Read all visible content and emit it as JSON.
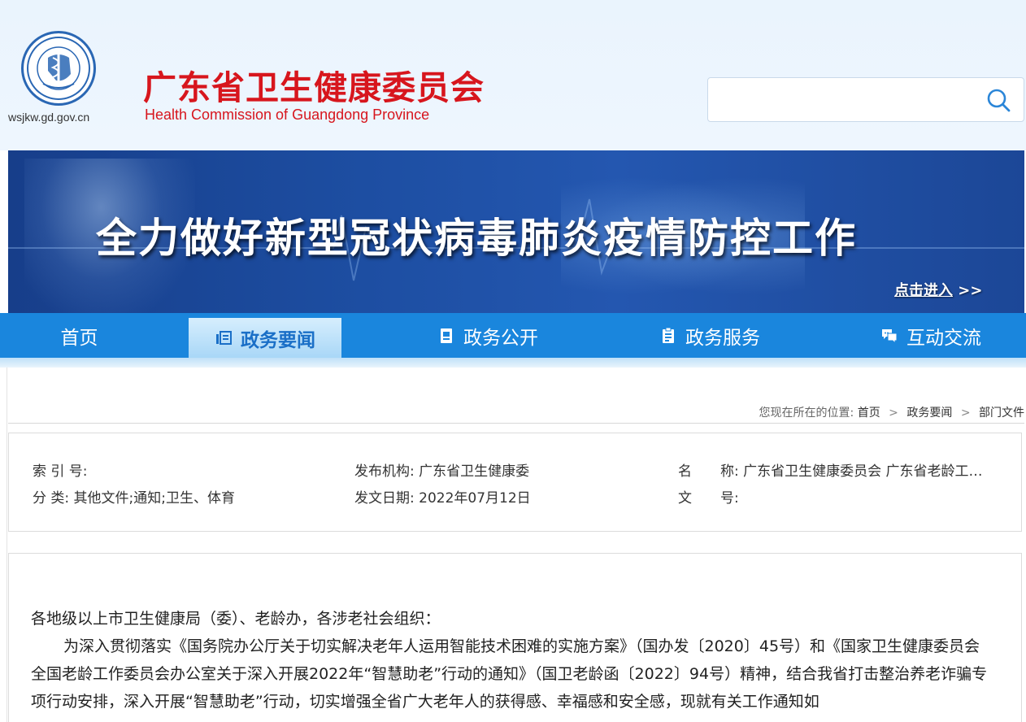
{
  "header": {
    "domain": "wsjkw.gd.gov.cn",
    "title": "广东省卫生健康委员会",
    "subtitle": "Health Commission of Guangdong Province",
    "search": {
      "value": "",
      "placeholder": ""
    },
    "emblem_icon": "health-commission-emblem"
  },
  "banner": {
    "headline": "全力做好新型冠状病毒肺炎疫情防控工作",
    "enter_label": "点击进入",
    "enter_arrows": ">>"
  },
  "nav": {
    "items": [
      {
        "label": "首页",
        "icon": ""
      },
      {
        "label": "政务要闻",
        "icon": "news-icon",
        "active": true
      },
      {
        "label": "政务公开",
        "icon": "document-icon"
      },
      {
        "label": "政务服务",
        "icon": "clipboard-icon"
      },
      {
        "label": "互动交流",
        "icon": "chat-icon"
      }
    ]
  },
  "breadcrumb": {
    "prefix": "您现在所在的位置:",
    "items": [
      "首页",
      "政务要闻",
      "部门文件"
    ],
    "separator": ">"
  },
  "meta": {
    "index_label": "索 引 号:",
    "index_value": "",
    "publisher_label": "发布机构:",
    "publisher_value": "广东省卫生健康委",
    "name_label": "名",
    "name_label_2": "称:",
    "name_value": "广东省卫生健康委员会 广东省老龄工…",
    "category_label": "分 类:",
    "category_value": "其他文件;通知;卫生、体育",
    "date_label": "发文日期:",
    "date_value": "2022年07月12日",
    "doc_no_label": "文",
    "doc_no_label_2": "号:",
    "doc_no_value": ""
  },
  "article": {
    "salutation": "各地级以上市卫生健康局（委）、老龄办，各涉老社会组织：",
    "paragraph_1": "为深入贯彻落实《国务院办公厅关于切实解决老年人运用智能技术困难的实施方案》（国办发〔2020〕45号）和《国家卫生健康委员会 全国老龄工作委员会办公室关于深入开展2022年“智慧助老”行动的通知》（国卫老龄函〔2022〕94号）精神，结合我省打击整治养老诈骗专项行动安排，深入开展“智慧助老”行动，切实增强全省广大老年人的获得感、幸福感和安全感，现就有关工作通知如"
  },
  "colors": {
    "brand_red": "#d7161d",
    "nav_blue": "#1a86dd",
    "banner_blue": "#1d4ea2",
    "active_tab_text": "#1a6fc7"
  }
}
